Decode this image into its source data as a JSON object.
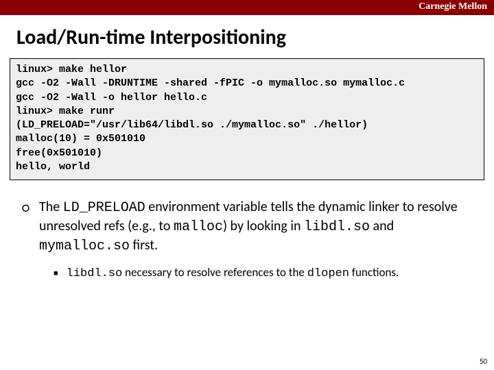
{
  "brand": "Carnegie Mellon",
  "title": "Load/Run-time Interpositioning",
  "code_lines": [
    "linux> make hellor",
    "gcc -O2 -Wall -DRUNTIME -shared -fPIC -o mymalloc.so mymalloc.c",
    "gcc -O2 -Wall -o hellor hello.c",
    "linux> make runr",
    "(LD_PRELOAD=\"/usr/lib64/libdl.so ./mymalloc.so\" ./hellor)",
    "malloc(10) = 0x501010",
    "free(0x501010)",
    "hello, world"
  ],
  "bullet": {
    "pre": " The ",
    "code1": "LD_PRELOAD",
    "mid1": " environment variable tells the dynamic linker to resolve unresolved refs (e.g., to ",
    "code2": "malloc",
    "mid2": ") by looking in ",
    "code3": "libdl.so",
    "mid3": " and ",
    "code4": "mymalloc.so",
    "post": " first."
  },
  "subbullet": {
    "code1": "libdl.so",
    "mid": " necessary to resolve references to the ",
    "code2": "dlopen",
    "post": " functions."
  },
  "page_number": "50"
}
